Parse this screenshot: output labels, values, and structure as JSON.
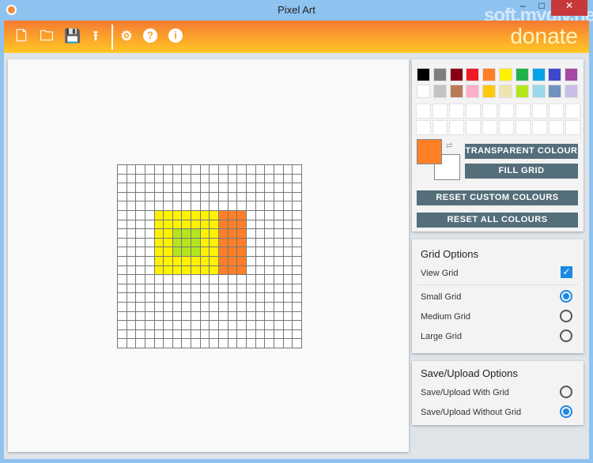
{
  "window": {
    "title": "Pixel Art",
    "close": "✕",
    "watermark": "soft.mydiv.net"
  },
  "toolbar": {
    "items": [
      {
        "name": "new-file-icon",
        "glyph": "🗋"
      },
      {
        "name": "open-folder-icon",
        "glyph": "🗀"
      },
      {
        "name": "save-icon",
        "glyph": "💾"
      },
      {
        "name": "upload-icon",
        "glyph": "⭱"
      },
      {
        "name": "settings-icon",
        "glyph": "⚙"
      },
      {
        "name": "help-icon",
        "glyph": "?"
      },
      {
        "name": "info-icon",
        "glyph": "i"
      }
    ],
    "donate": "donate"
  },
  "palette": {
    "colors": [
      "#000000",
      "#7f7f7f",
      "#880015",
      "#ed1c24",
      "#ff7f27",
      "#fff200",
      "#22b14c",
      "#00a2e8",
      "#3f48cc",
      "#a349a4",
      "#ffffff",
      "#c3c3c3",
      "#b97a57",
      "#ffaec9",
      "#ffc90e",
      "#efe4b0",
      "#b5e61d",
      "#99d9ea",
      "#7092be",
      "#c8bfe7"
    ],
    "foreground": "#ff7f27",
    "background": "#ffffff",
    "transparent_label": "TRANSPARENT COLOUR",
    "fill_label": "FILL GRID",
    "reset_custom_label": "RESET CUSTOM COLOURS",
    "reset_all_label": "RESET ALL COLOURS"
  },
  "grid_options": {
    "title": "Grid Options",
    "view_grid": "View Grid",
    "view_grid_checked": true,
    "small": "Small Grid",
    "medium": "Medium Grid",
    "large": "Large Grid",
    "selected": "small"
  },
  "save_options": {
    "title": "Save/Upload Options",
    "with": "Save/Upload With Grid",
    "without": "Save/Upload Without Grid",
    "selected": "without"
  },
  "canvas": {
    "cols": 20,
    "rows": 20,
    "fills": [
      {
        "color": "#fff200",
        "cols": [
          4,
          10
        ],
        "rows": [
          5,
          11
        ]
      },
      {
        "color": "#ff7f27",
        "cols": [
          11,
          13
        ],
        "rows": [
          5,
          11
        ]
      },
      {
        "color": "#b5e61d",
        "cols": [
          6,
          8
        ],
        "rows": [
          7,
          9
        ]
      }
    ]
  }
}
